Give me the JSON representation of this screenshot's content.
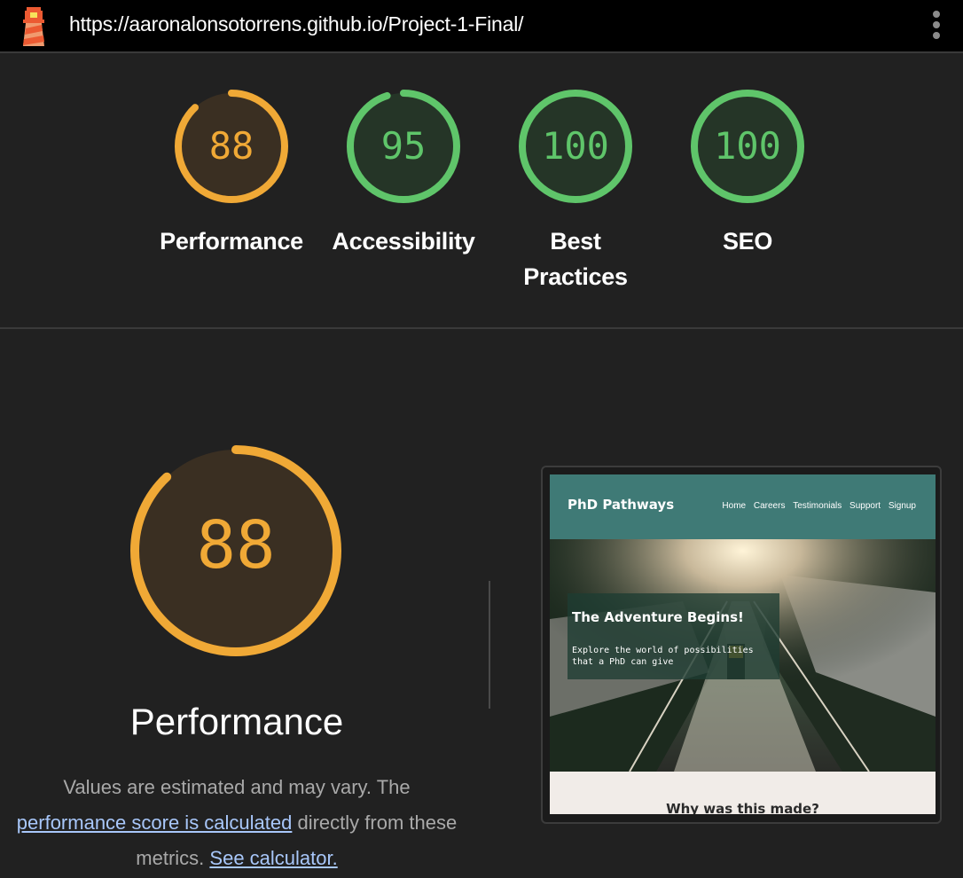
{
  "topbar": {
    "url": "https://aaronalonsotorrens.github.io/Project-1-Final/"
  },
  "scores": [
    {
      "label": "Performance",
      "score": 88,
      "status": "average",
      "color": "#f0a936"
    },
    {
      "label": "Accessibility",
      "score": 95,
      "status": "pass",
      "color": "#5fc56a"
    },
    {
      "label": "Best Practices",
      "score": 100,
      "status": "pass",
      "color": "#5fc56a"
    },
    {
      "label": "SEO",
      "score": 100,
      "status": "pass",
      "color": "#5fc56a"
    }
  ],
  "performance": {
    "score": 88,
    "title": "Performance",
    "desc_prefix": "Values are estimated and may vary. The ",
    "desc_link": "performance score is calculated",
    "desc_mid": " directly from these metrics. ",
    "calc_link": "See calculator."
  },
  "preview": {
    "brand": "PhD Pathways",
    "nav": [
      "Home",
      "Careers",
      "Testimonials",
      "Support",
      "Signup"
    ],
    "hero_title": "The Adventure Begins!",
    "hero_sub": "Explore the world of possibilities that a PhD can give",
    "section_title": "Why was this made?"
  },
  "colors": {
    "background": "#212121",
    "average": "#f0a936",
    "pass": "#5fc56a",
    "link": "#a8c7fa"
  }
}
